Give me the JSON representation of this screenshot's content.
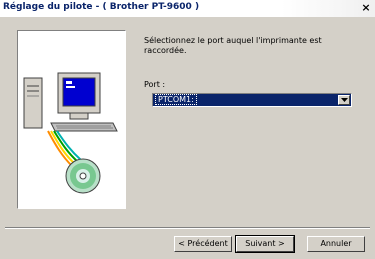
{
  "window": {
    "title": "Réglage du pilote - ( Brother PT-9600 )",
    "close_glyph": "×"
  },
  "content": {
    "message": "Sélectionnez le port auquel l'imprimante est raccordée.",
    "port_label": "Port :",
    "port_value": "PTCOM1:"
  },
  "buttons": {
    "prev": "< Précédent",
    "next": "Suivant >",
    "cancel": "Annuler"
  },
  "icons": {
    "illustration": "computer-cable-cd-illustration",
    "dropdown": "chevron-down-icon"
  },
  "colors": {
    "title_text": "#0a246a",
    "selection": "#0a246a",
    "face": "#d4d0c8"
  }
}
